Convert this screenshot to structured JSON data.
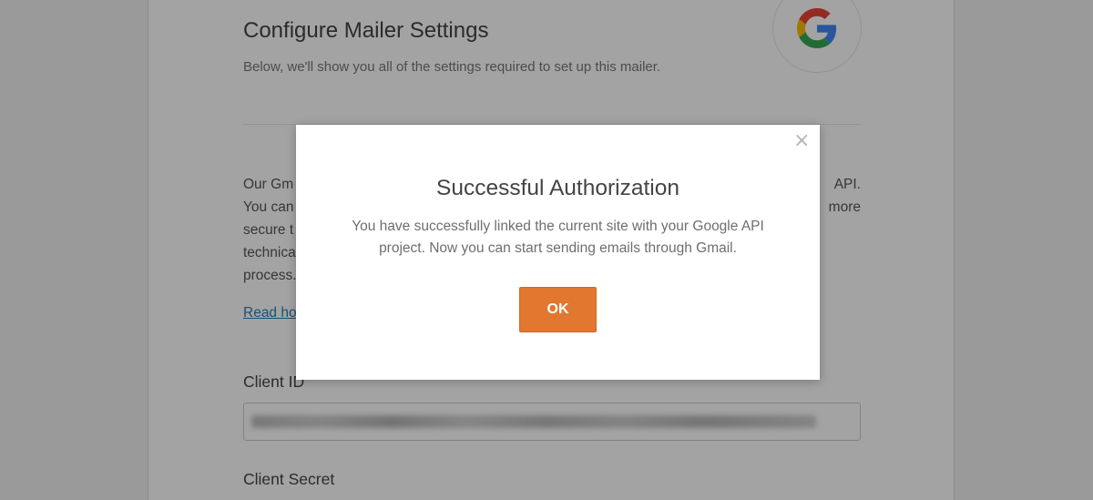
{
  "page": {
    "title": "Configure Mailer Settings",
    "subtitle": "Below, we'll show you all of the settings required to set up this mailer.",
    "logo_icon": "google-g-icon",
    "description": {
      "line1_start": "Our Gm",
      "line1_end": "API.",
      "line2_start": "You can",
      "line2_end": "more",
      "line3_start": "secure t",
      "line4_start": "technica",
      "line5_start": "process."
    },
    "read_link": "Read ho",
    "client_id_label": "Client ID",
    "client_id_value": "",
    "client_secret_label": "Client Secret"
  },
  "modal": {
    "title": "Successful Authorization",
    "message": "You have successfully linked the current site with your Google API project. Now you can start sending emails through Gmail.",
    "ok_label": "OK",
    "close_label": "×",
    "close_icon": "close-icon"
  },
  "colors": {
    "accent": "#e27730",
    "link": "#2a7fb8",
    "overlay": "rgba(0,0,0,0.36)"
  }
}
